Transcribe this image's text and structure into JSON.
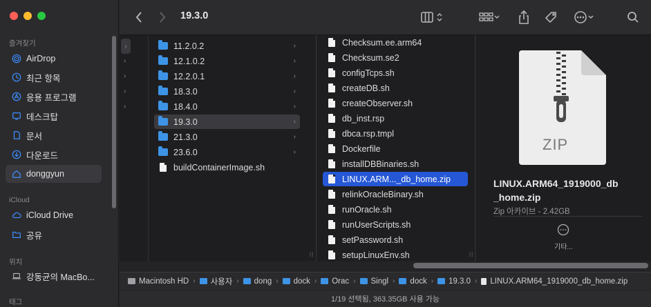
{
  "window": {
    "title": "19.3.0"
  },
  "sidebar": {
    "sections": [
      {
        "label": "즐겨찾기"
      },
      {
        "label": "iCloud"
      },
      {
        "label": "위치"
      },
      {
        "label": "태그"
      }
    ],
    "favorites": [
      {
        "label": "AirDrop",
        "icon": "airdrop-icon"
      },
      {
        "label": "최근 항목",
        "icon": "clock-icon"
      },
      {
        "label": "응용 프로그램",
        "icon": "apps-icon"
      },
      {
        "label": "데스크탑",
        "icon": "desktop-icon"
      },
      {
        "label": "문서",
        "icon": "document-icon"
      },
      {
        "label": "다운로드",
        "icon": "download-icon"
      },
      {
        "label": "donggyun",
        "icon": "home-icon"
      }
    ],
    "icloud": [
      {
        "label": "iCloud Drive",
        "icon": "cloud-icon"
      },
      {
        "label": "공유",
        "icon": "shared-folder-icon"
      }
    ],
    "locations": [
      {
        "label": "강동균의 MacBo...",
        "icon": "laptop-icon"
      }
    ]
  },
  "column1": [
    {
      "name": "11.2.0.2",
      "type": "folder"
    },
    {
      "name": "12.1.0.2",
      "type": "folder"
    },
    {
      "name": "12.2.0.1",
      "type": "folder"
    },
    {
      "name": "18.3.0",
      "type": "folder"
    },
    {
      "name": "18.4.0",
      "type": "folder"
    },
    {
      "name": "19.3.0",
      "type": "folder"
    },
    {
      "name": "21.3.0",
      "type": "folder"
    },
    {
      "name": "23.6.0",
      "type": "folder"
    },
    {
      "name": "buildContainerImage.sh",
      "type": "file"
    }
  ],
  "column2": [
    {
      "name": "Checksum.ee.arm64"
    },
    {
      "name": "Checksum.se2"
    },
    {
      "name": "configTcps.sh"
    },
    {
      "name": "createDB.sh"
    },
    {
      "name": "createObserver.sh"
    },
    {
      "name": "db_inst.rsp"
    },
    {
      "name": "dbca.rsp.tmpl"
    },
    {
      "name": "Dockerfile"
    },
    {
      "name": "installDBBinaries.sh"
    },
    {
      "name": "LINUX.ARM..._db_home.zip"
    },
    {
      "name": "relinkOracleBinary.sh"
    },
    {
      "name": "runOracle.sh"
    },
    {
      "name": "runUserScripts.sh"
    },
    {
      "name": "setPassword.sh"
    },
    {
      "name": "setupLinuxEnv.sh"
    }
  ],
  "preview": {
    "badge": "ZIP",
    "name_line1": "LINUX.ARM64_1919000_db",
    "name_line2": "_home.zip",
    "kind": "Zip 아카이브 - 2.42GB",
    "more_label": "기타..."
  },
  "pathbar": [
    {
      "label": "Macintosh HD",
      "kind": "disk"
    },
    {
      "label": "사용자",
      "kind": "folder"
    },
    {
      "label": "dong",
      "kind": "folder"
    },
    {
      "label": "dock",
      "kind": "folder"
    },
    {
      "label": "Orac",
      "kind": "folder"
    },
    {
      "label": "Singl",
      "kind": "folder"
    },
    {
      "label": "dock",
      "kind": "folder"
    },
    {
      "label": "19.3.0",
      "kind": "folder"
    },
    {
      "label": "LINUX.ARM64_1919000_db_home.zip",
      "kind": "file"
    }
  ],
  "status": {
    "text": "1/19 선택됨, 363.35GB 사용 가능"
  },
  "colors": {
    "accent": "#2557d6",
    "folder": "#3d94e6"
  }
}
